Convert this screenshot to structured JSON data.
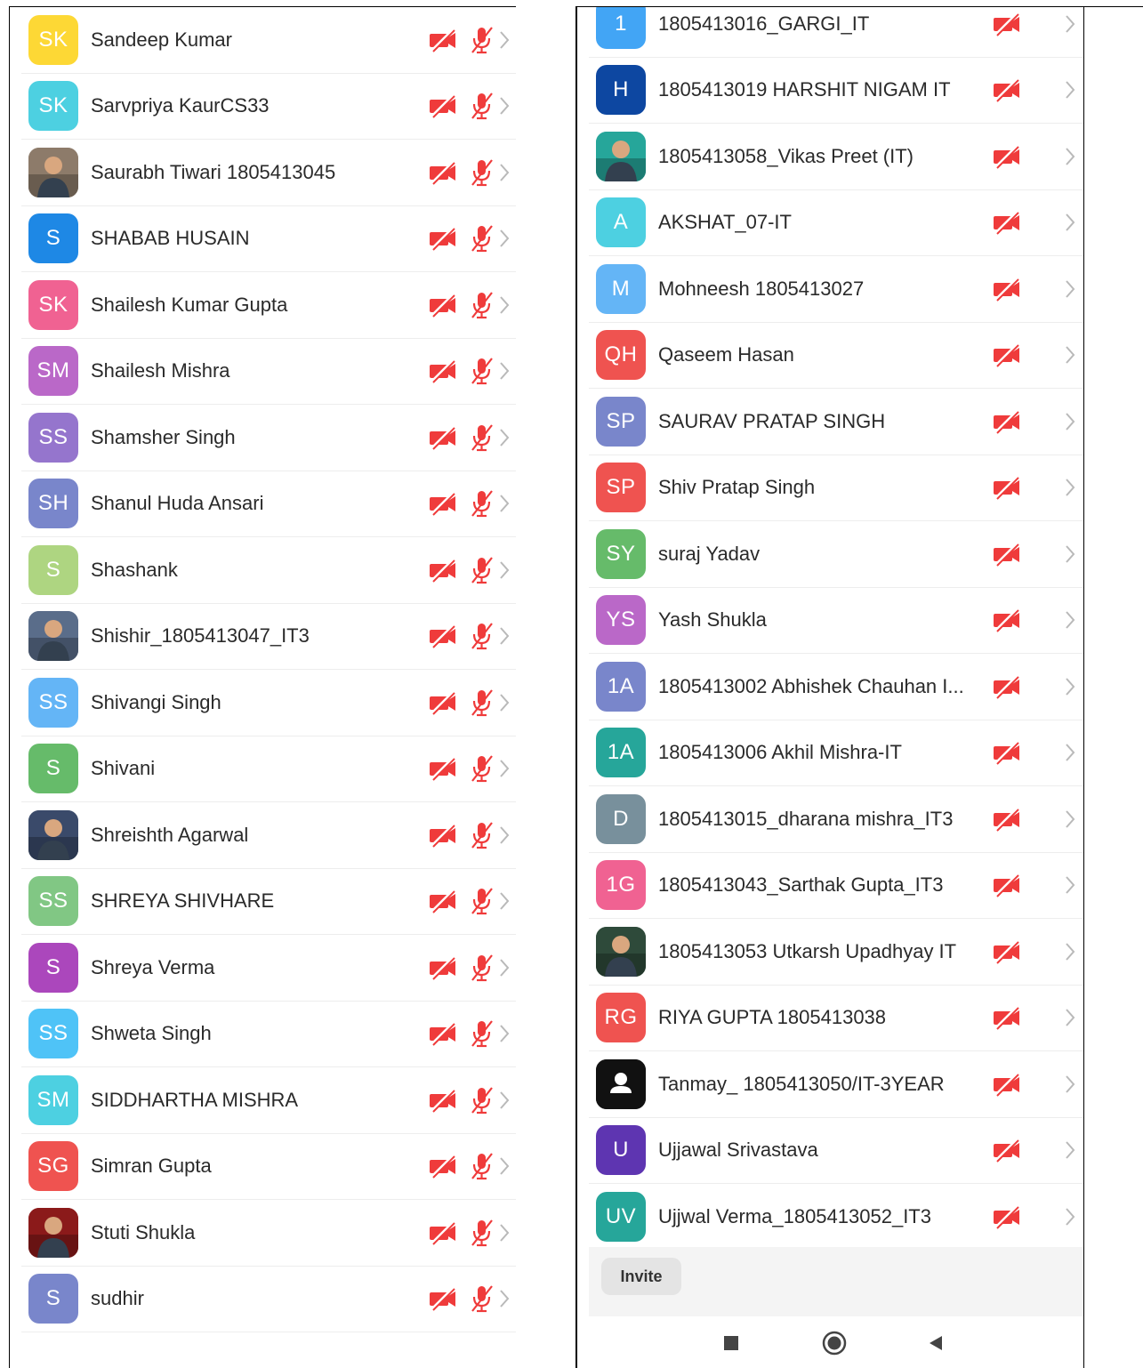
{
  "colors": {
    "muted_icon": "#ef3b3b",
    "chevron": "#b9b9b9",
    "divider": "#ededed"
  },
  "left_list": [
    {
      "initials": "SK",
      "name": "Sandeep Kumar",
      "color": "#fdd835",
      "photo": false
    },
    {
      "initials": "SK",
      "name": "Sarvpriya KaurCS33",
      "color": "#4dd0e1",
      "photo": false
    },
    {
      "initials": "",
      "name": "Saurabh Tiwari 1805413045",
      "color": "#8d7b6a",
      "photo": true
    },
    {
      "initials": "S",
      "name": "SHABAB HUSAIN",
      "color": "#1e88e5",
      "photo": false
    },
    {
      "initials": "SK",
      "name": "Shailesh Kumar Gupta",
      "color": "#f06292",
      "photo": false
    },
    {
      "initials": "SM",
      "name": "Shailesh Mishra",
      "color": "#ba68c8",
      "photo": false
    },
    {
      "initials": "SS",
      "name": "Shamsher Singh",
      "color": "#9575cd",
      "photo": false
    },
    {
      "initials": "SH",
      "name": "Shanul Huda Ansari",
      "color": "#7986cb",
      "photo": false
    },
    {
      "initials": "S",
      "name": "Shashank",
      "color": "#aed581",
      "photo": false
    },
    {
      "initials": "",
      "name": "Shishir_1805413047_IT3",
      "color": "#5a6d8a",
      "photo": true
    },
    {
      "initials": "SS",
      "name": "Shivangi Singh",
      "color": "#64b5f6",
      "photo": false
    },
    {
      "initials": "S",
      "name": "Shivani",
      "color": "#66bb6a",
      "photo": false
    },
    {
      "initials": "",
      "name": "Shreishth Agarwal",
      "color": "#3a4a6a",
      "photo": true
    },
    {
      "initials": "SS",
      "name": "SHREYA SHIVHARE",
      "color": "#81c784",
      "photo": false
    },
    {
      "initials": "S",
      "name": "Shreya Verma",
      "color": "#ab47bc",
      "photo": false
    },
    {
      "initials": "SS",
      "name": "Shweta Singh",
      "color": "#4fc3f7",
      "photo": false
    },
    {
      "initials": "SM",
      "name": "SIDDHARTHA MISHRA",
      "color": "#4dd0e1",
      "photo": false
    },
    {
      "initials": "SG",
      "name": "Simran Gupta",
      "color": "#ef5350",
      "photo": false
    },
    {
      "initials": "",
      "name": "Stuti Shukla",
      "color": "#8b1a1a",
      "photo": true
    },
    {
      "initials": "S",
      "name": "sudhir",
      "color": "#7986cb",
      "photo": false
    }
  ],
  "right_list": [
    {
      "initials": "1",
      "name": "1805413016_GARGI_IT",
      "color": "#42a5f5",
      "photo": false
    },
    {
      "initials": "H",
      "name": "1805413019 HARSHIT NIGAM IT",
      "color": "#0d47a1",
      "photo": false
    },
    {
      "initials": "",
      "name": "1805413058_Vikas Preet (IT)",
      "color": "#26a69a",
      "photo": true
    },
    {
      "initials": "A",
      "name": "AKSHAT_07-IT",
      "color": "#4dd0e1",
      "photo": false
    },
    {
      "initials": "M",
      "name": "Mohneesh  1805413027",
      "color": "#64b5f6",
      "photo": false
    },
    {
      "initials": "QH",
      "name": "Qaseem Hasan",
      "color": "#ef5350",
      "photo": false
    },
    {
      "initials": "SP",
      "name": "SAURAV PRATAP SINGH",
      "color": "#7986cb",
      "photo": false
    },
    {
      "initials": "SP",
      "name": "Shiv Pratap Singh",
      "color": "#ef5350",
      "photo": false
    },
    {
      "initials": "SY",
      "name": "suraj Yadav",
      "color": "#66bb6a",
      "photo": false
    },
    {
      "initials": "YS",
      "name": "Yash Shukla",
      "color": "#ba68c8",
      "photo": false
    },
    {
      "initials": "1A",
      "name": "1805413002 Abhishek Chauhan I...",
      "color": "#7986cb",
      "photo": false
    },
    {
      "initials": "1A",
      "name": "1805413006 Akhil Mishra-IT",
      "color": "#26a69a",
      "photo": false
    },
    {
      "initials": "D",
      "name": "1805413015_dharana mishra_IT3",
      "color": "#78909c",
      "photo": false
    },
    {
      "initials": "1G",
      "name": "1805413043_Sarthak Gupta_IT3",
      "color": "#f06292",
      "photo": false
    },
    {
      "initials": "",
      "name": "1805413053 Utkarsh Upadhyay IT",
      "color": "#2e4a3a",
      "photo": true
    },
    {
      "initials": "RG",
      "name": "RIYA GUPTA 1805413038",
      "color": "#ef5350",
      "photo": false
    },
    {
      "initials": "",
      "name": "Tanmay_ 1805413050/IT-3YEAR",
      "color": "#111111",
      "photo": false,
      "default_avatar": true
    },
    {
      "initials": "U",
      "name": "Ujjawal Srivastava",
      "color": "#5e35b1",
      "photo": false
    },
    {
      "initials": "UV",
      "name": "Ujjwal Verma_1805413052_IT3",
      "color": "#26a69a",
      "photo": false
    }
  ],
  "invite_label": "Invite",
  "nav": {
    "recents": "square-recents-icon",
    "home": "circle-home-icon",
    "back": "triangle-back-icon"
  }
}
